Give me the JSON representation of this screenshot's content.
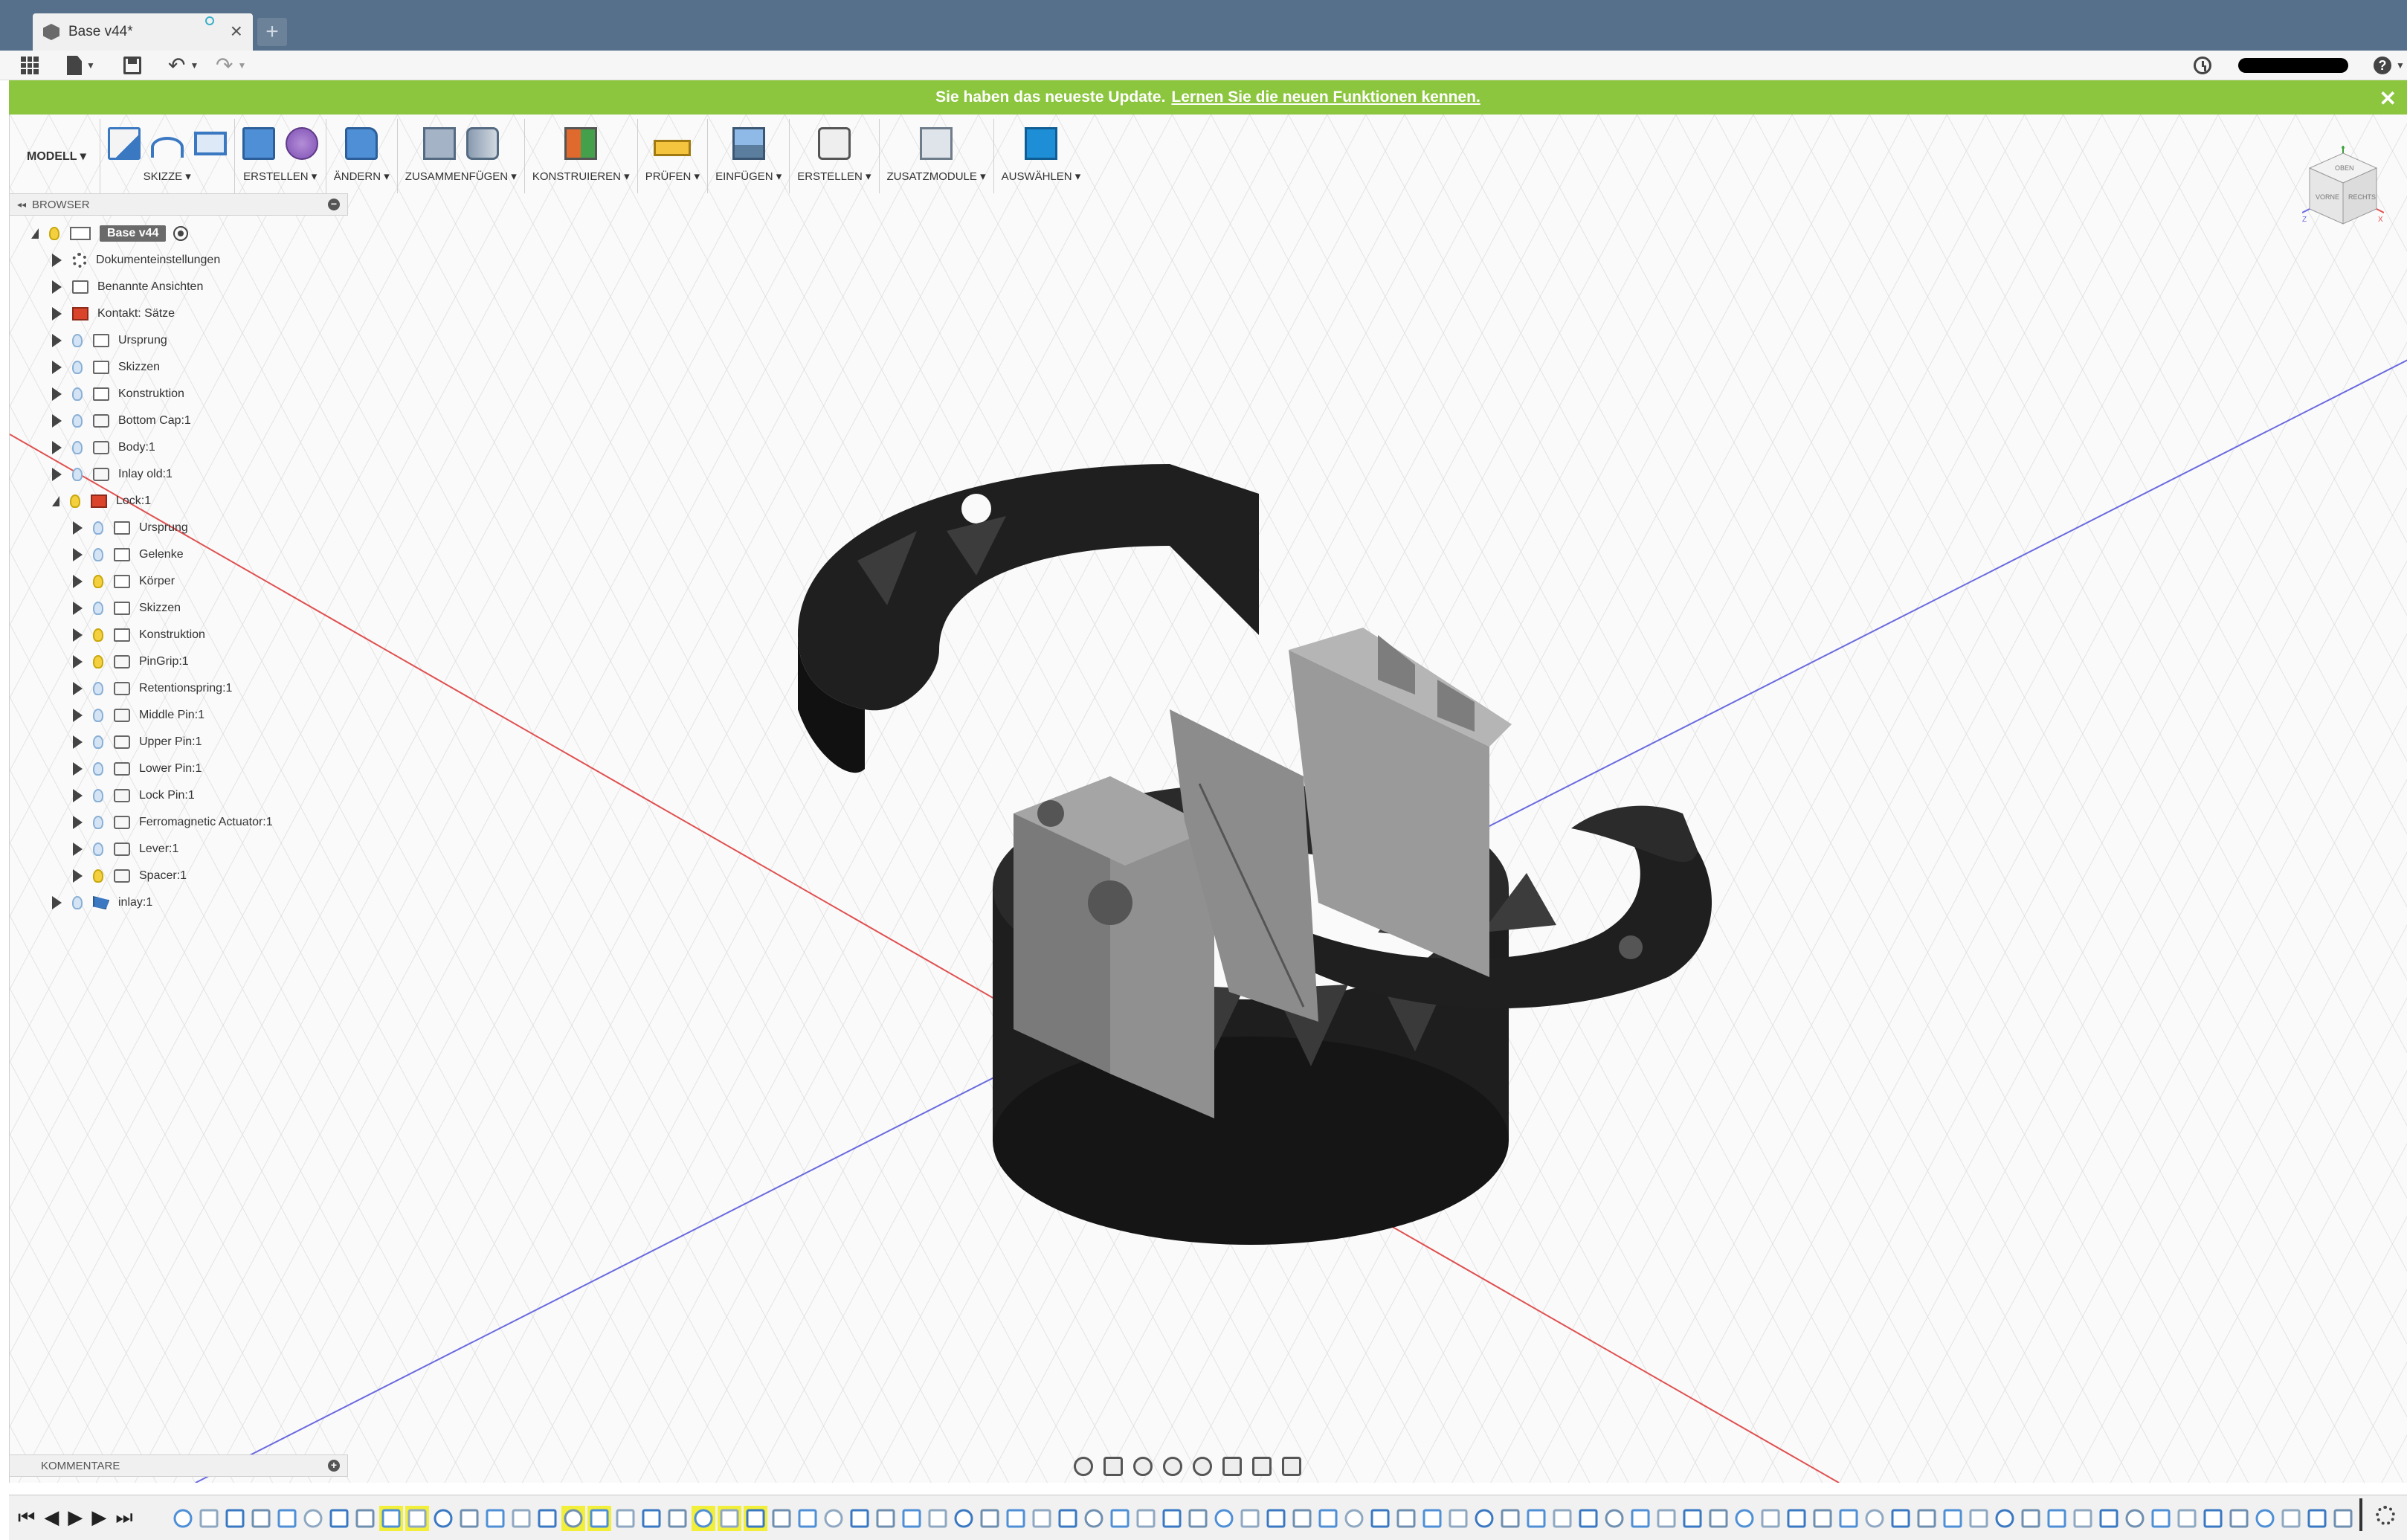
{
  "document": {
    "tab_title": "Base v44*",
    "new_tab": "+"
  },
  "banner": {
    "text": "Sie haben das neueste Update.",
    "link": "Lernen Sie die neuen Funktionen kennen.",
    "close": "✕"
  },
  "toolbar": {
    "workspace": "MODELL ▾",
    "groups": [
      {
        "label": "SKIZZE ▾"
      },
      {
        "label": "ERSTELLEN ▾"
      },
      {
        "label": "ÄNDERN ▾"
      },
      {
        "label": "ZUSAMMENFÜGEN ▾"
      },
      {
        "label": "KONSTRUIEREN ▾"
      },
      {
        "label": "PRÜFEN ▾"
      },
      {
        "label": "EINFÜGEN ▾"
      },
      {
        "label": "ERSTELLEN ▾"
      },
      {
        "label": "ZUSATZMODULE ▾"
      },
      {
        "label": "AUSWÄHLEN ▾"
      }
    ]
  },
  "browser": {
    "title": "BROWSER",
    "collapse": "◂◂",
    "minus": "−",
    "items": [
      {
        "label": "Base v44"
      },
      {
        "label": "Dokumenteinstellungen"
      },
      {
        "label": "Benannte Ansichten"
      },
      {
        "label": "Kontakt: Sätze"
      },
      {
        "label": "Ursprung"
      },
      {
        "label": "Skizzen"
      },
      {
        "label": "Konstruktion"
      },
      {
        "label": "Bottom Cap:1"
      },
      {
        "label": "Body:1"
      },
      {
        "label": "Inlay old:1"
      },
      {
        "label": "Lock:1"
      },
      {
        "label": "Ursprung"
      },
      {
        "label": "Gelenke"
      },
      {
        "label": "Körper"
      },
      {
        "label": "Skizzen"
      },
      {
        "label": "Konstruktion"
      },
      {
        "label": "PinGrip:1"
      },
      {
        "label": "Retentionspring:1"
      },
      {
        "label": "Middle Pin:1"
      },
      {
        "label": "Upper Pin:1"
      },
      {
        "label": "Lower Pin:1"
      },
      {
        "label": "Lock Pin:1"
      },
      {
        "label": "Ferromagnetic Actuator:1"
      },
      {
        "label": "Lever:1"
      },
      {
        "label": "Spacer:1"
      },
      {
        "label": "inlay:1"
      }
    ]
  },
  "viewcube": {
    "top": "OBEN",
    "front": "VORNE",
    "right": "RECHTS",
    "z": "Z",
    "x": "X",
    "y": "Y"
  },
  "comments": {
    "title": "KOMMENTARE",
    "plus": "+"
  },
  "timeline": {
    "first": "⏮",
    "prev": "◀",
    "play": "▶",
    "next": "▶",
    "last": "⏭"
  },
  "colors": {
    "title_bar": "#566f8a",
    "banner": "#8cc63f",
    "accent": "#3a78c2",
    "x_axis": "#e05050",
    "y_axis": "#6a6ae0"
  }
}
